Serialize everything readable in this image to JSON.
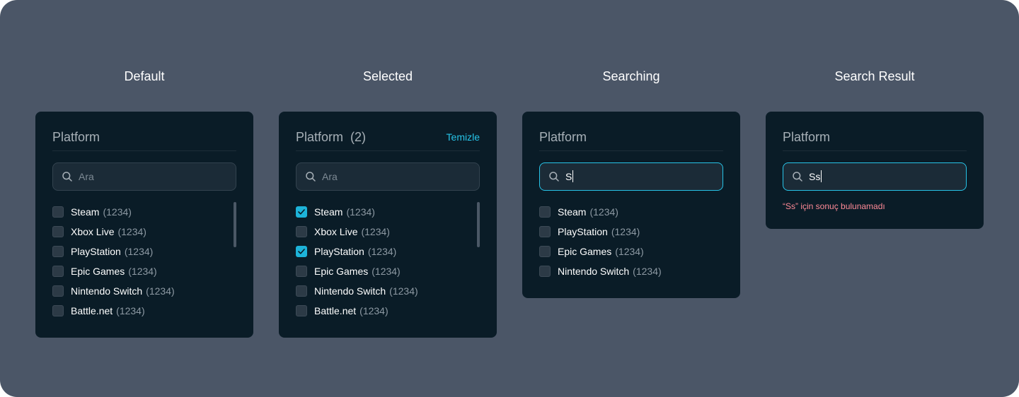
{
  "colors": {
    "canvas_bg": "#4b5667",
    "panel_bg": "#0a1c27",
    "accent": "#27c4e8",
    "error": "#ff8a97"
  },
  "states": [
    {
      "title": "Default",
      "panel": {
        "title": "Platform",
        "clear_label": "",
        "search": {
          "value": "",
          "placeholder": "Ara",
          "focused": false
        },
        "items": [
          {
            "label": "Steam",
            "count": "(1234)",
            "checked": false
          },
          {
            "label": "Xbox Live",
            "count": "(1234)",
            "checked": false
          },
          {
            "label": "PlayStation",
            "count": "(1234)",
            "checked": false
          },
          {
            "label": "Epic Games",
            "count": "(1234)",
            "checked": false
          },
          {
            "label": "Nintendo Switch",
            "count": "(1234)",
            "checked": false
          },
          {
            "label": "Battle.net",
            "count": "(1234)",
            "checked": false
          }
        ]
      }
    },
    {
      "title": "Selected",
      "panel": {
        "title": "Platform  (2)",
        "clear_label": "Temizle",
        "search": {
          "value": "",
          "placeholder": "Ara",
          "focused": false
        },
        "items": [
          {
            "label": "Steam",
            "count": "(1234)",
            "checked": true
          },
          {
            "label": "Xbox Live",
            "count": "(1234)",
            "checked": false
          },
          {
            "label": "PlayStation",
            "count": "(1234)",
            "checked": true
          },
          {
            "label": "Epic Games",
            "count": "(1234)",
            "checked": false
          },
          {
            "label": "Nintendo Switch",
            "count": "(1234)",
            "checked": false
          },
          {
            "label": "Battle.net",
            "count": "(1234)",
            "checked": false
          }
        ]
      }
    },
    {
      "title": "Searching",
      "panel": {
        "title": "Platform",
        "clear_label": "",
        "search": {
          "value": "S",
          "placeholder": "Ara",
          "focused": true
        },
        "items": [
          {
            "label": "Steam",
            "count": "(1234)",
            "checked": false
          },
          {
            "label": "PlayStation",
            "count": "(1234)",
            "checked": false
          },
          {
            "label": "Epic Games",
            "count": "(1234)",
            "checked": false
          },
          {
            "label": "Nintendo Switch",
            "count": "(1234)",
            "checked": false
          }
        ]
      }
    },
    {
      "title": "Search Result",
      "panel": {
        "title": "Platform",
        "clear_label": "",
        "search": {
          "value": "Ss",
          "placeholder": "Ara",
          "focused": true
        },
        "items": [],
        "no_result": "“Ss” için sonuç bulunamadı"
      }
    }
  ]
}
